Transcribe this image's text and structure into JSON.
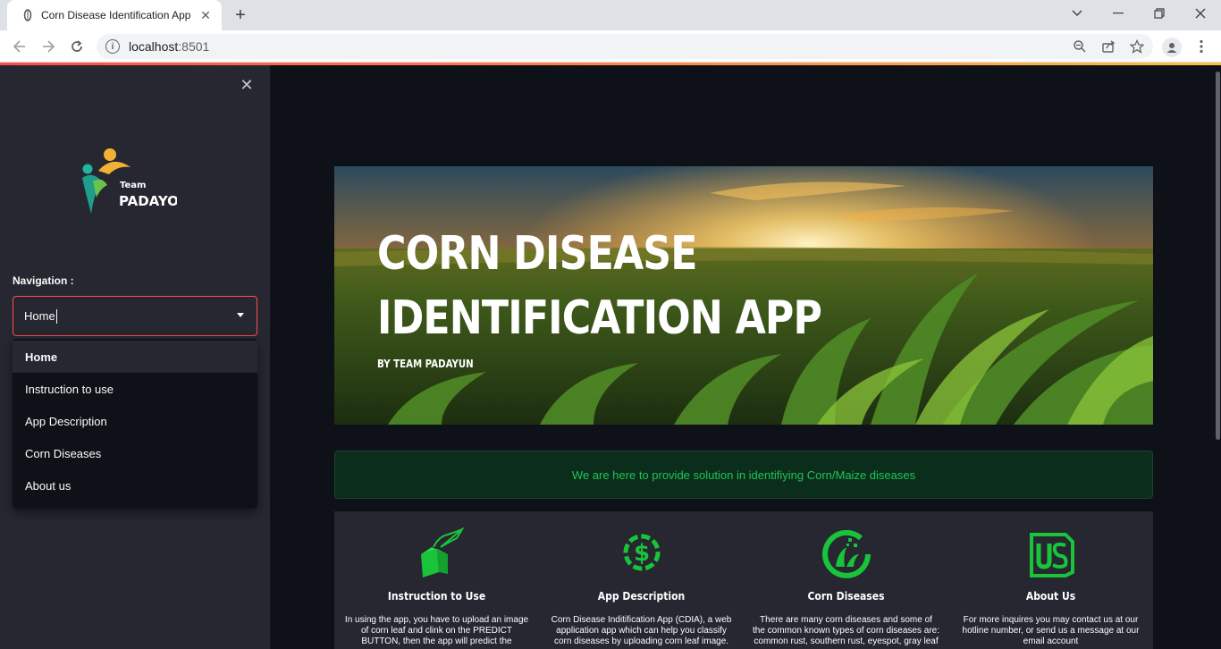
{
  "browser": {
    "tab_title": "Corn Disease Identification App",
    "url_host": "localhost",
    "url_port": ":8501"
  },
  "sidebar": {
    "logo_team": "Team",
    "logo_name": "PADAYON",
    "nav_label": "Navigation :",
    "selected": "Home",
    "options": [
      "Home",
      "Instruction to use",
      "App Description",
      "Corn Diseases",
      "About us"
    ]
  },
  "banner": {
    "line1": "CORN DISEASE",
    "line2": "IDENTIFICATION APP",
    "byline": "BY TEAM PADAYUN"
  },
  "alert": {
    "text": "We are here to provide solution in identifiying Corn/Maize diseases"
  },
  "cards": [
    {
      "title": "Instruction to Use",
      "icon": "instruction-icon",
      "desc": "In using the app, you have to upload an image of corn leaf and clink on the PREDICT BUTTON, then the app will predict the"
    },
    {
      "title": "App Description",
      "icon": "app-description-icon",
      "desc": "Corn Disease Inditification App (CDIA), a web application app which can help you classify corn diseases by uploading corn leaf image."
    },
    {
      "title": "Corn Diseases",
      "icon": "corn-diseases-icon",
      "desc": "There are many corn diseases and some of the common known types of corn diseases are: common rust, southern rust, eyespot, gray leaf"
    },
    {
      "title": "About Us",
      "icon": "about-us-icon",
      "desc": "For more inquires you may contact us at our hotline number, or send us a message at our email account"
    }
  ],
  "colors": {
    "accent_red": "#ff4b4b",
    "success_green": "#21c354",
    "icon_green": "#19c43a",
    "sidebar_bg": "#262730",
    "main_bg": "#0e1117"
  }
}
